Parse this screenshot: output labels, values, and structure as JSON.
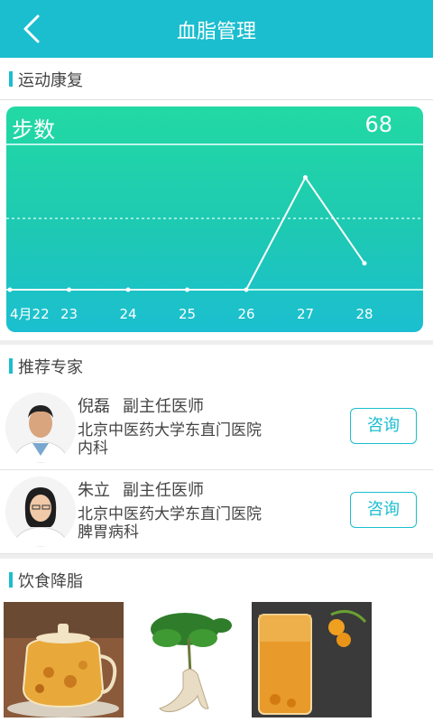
{
  "header": {
    "title": "血脂管理"
  },
  "sections": {
    "exercise": "运动康复",
    "experts": "推荐专家",
    "diet": "饮食降脂"
  },
  "chart_data": {
    "type": "line",
    "title": "步数",
    "current_value": "68",
    "categories": [
      "4月22",
      "23",
      "24",
      "25",
      "26",
      "27",
      "28"
    ],
    "series": [
      {
        "values": [
          0,
          0,
          0,
          0,
          0,
          68,
          16
        ]
      }
    ],
    "ylim": [
      0,
      70
    ],
    "grid": true,
    "colors": {
      "line": "#ffffff",
      "background_top": "#22d9a3",
      "background_bottom": "#1bbfd0"
    }
  },
  "experts": [
    {
      "name": "倪磊",
      "rank": "副主任医师",
      "hospital": "北京中医药大学东直门医院",
      "department": "内科",
      "button": "咨询"
    },
    {
      "name": "朱立",
      "rank": "副主任医师",
      "hospital": "北京中医药大学东直门医院",
      "department": "脾胃病科",
      "button": "咨询"
    }
  ],
  "colors": {
    "accent": "#1bbecf"
  },
  "icons": {
    "back": "chevron-left-icon"
  }
}
